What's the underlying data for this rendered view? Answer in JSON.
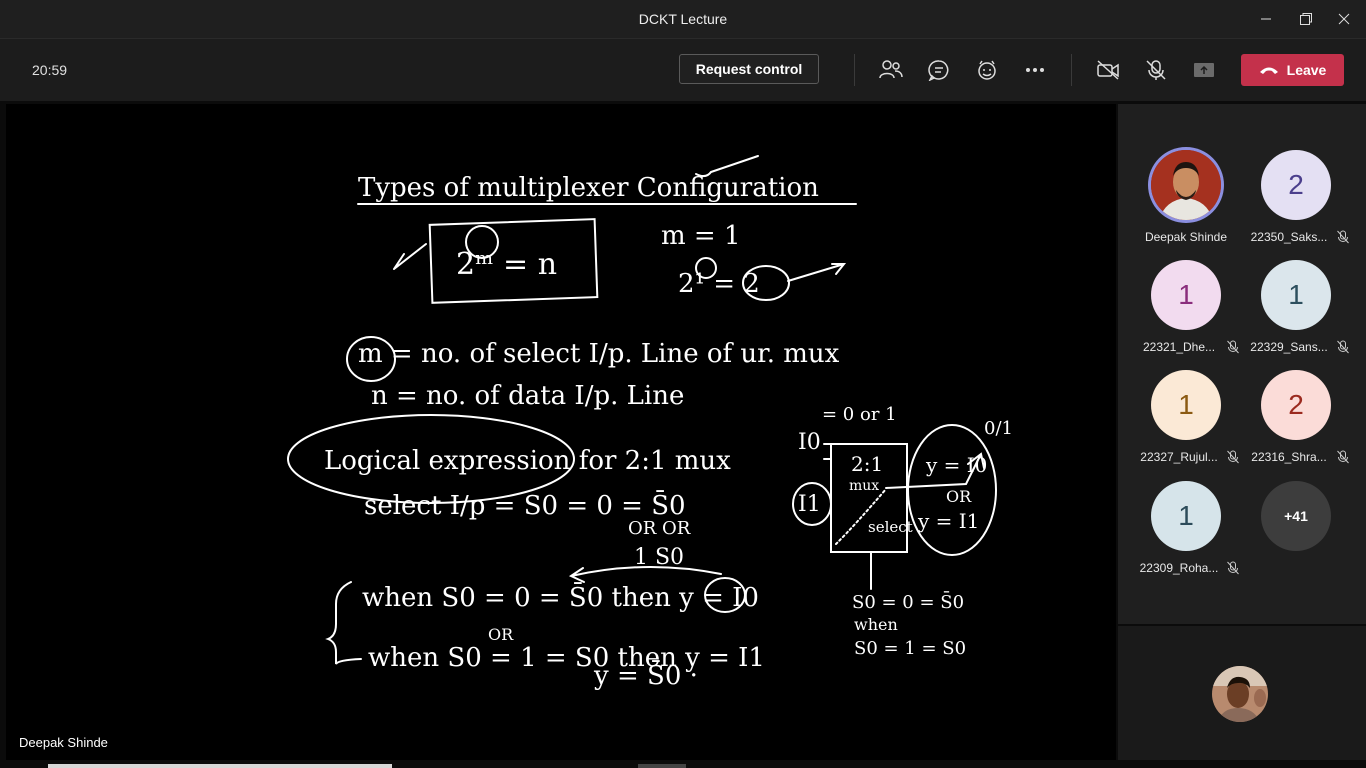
{
  "window": {
    "title": "DCKT Lecture"
  },
  "toolbar": {
    "time": "20:59",
    "request_control_label": "Request control",
    "leave_label": "Leave"
  },
  "stage": {
    "presenter_name": "Deepak Shinde",
    "board": {
      "heading": "Types of multiplexer Configuration",
      "formula": "2ᵐ = n",
      "example_m": "m = 1",
      "example_result": "2¹ = 2",
      "def_m": "m = no. of select I/p. Line of ur. mux",
      "def_n": "n = no. of data I/p. Line",
      "logical_title": "Logical expression for 2:1 mux",
      "select_eq": "select I/p = S0 = 0 = S̄0",
      "or_row": "OR  OR",
      "select_eq2": "1  S0",
      "when1": "when S0 = 0 = S̄0 then y = I0",
      "when2_or": "OR",
      "when2": "when S0 = 1 = S0 then y = I1",
      "y_eq": "y = S̄0 ·",
      "diagram": {
        "i0": "I0",
        "i0_val": "= 0 or 1",
        "i1": "I1",
        "mux_label": "2:1",
        "mux_sub": "mux",
        "select_label": "select",
        "out_val": "0/1",
        "y_i0": "y = I0",
        "or": "OR",
        "y_i1": "y = I1",
        "cond1": "S0 = 0 = S̄0",
        "when": "when",
        "cond2": "S0 = 1 = S0"
      }
    }
  },
  "participants": [
    {
      "name": "Deepak Shinde",
      "initial": "",
      "photo": true,
      "muted": false,
      "bg": "#8f2b1e",
      "fg": "#ffffff"
    },
    {
      "name": "22350_Saks...",
      "initial": "2",
      "muted": true,
      "bg": "#e4e0f3",
      "fg": "#4b3f8c"
    },
    {
      "name": "22321_Dhe...",
      "initial": "1",
      "muted": true,
      "bg": "#f2dbef",
      "fg": "#8a2d7c"
    },
    {
      "name": "22329_Sans...",
      "initial": "1",
      "muted": true,
      "bg": "#dbe6ec",
      "fg": "#2d4f5e"
    },
    {
      "name": "22327_Rujul...",
      "initial": "1",
      "muted": true,
      "bg": "#fbe9d6",
      "fg": "#8b5a12"
    },
    {
      "name": "22316_Shra...",
      "initial": "2",
      "muted": true,
      "bg": "#fbdcd8",
      "fg": "#9b2a1f"
    },
    {
      "name": "22309_Roha...",
      "initial": "1",
      "muted": true,
      "bg": "#d6e4ea",
      "fg": "#2c4b5a"
    }
  ],
  "overflow": {
    "label": "+41"
  }
}
